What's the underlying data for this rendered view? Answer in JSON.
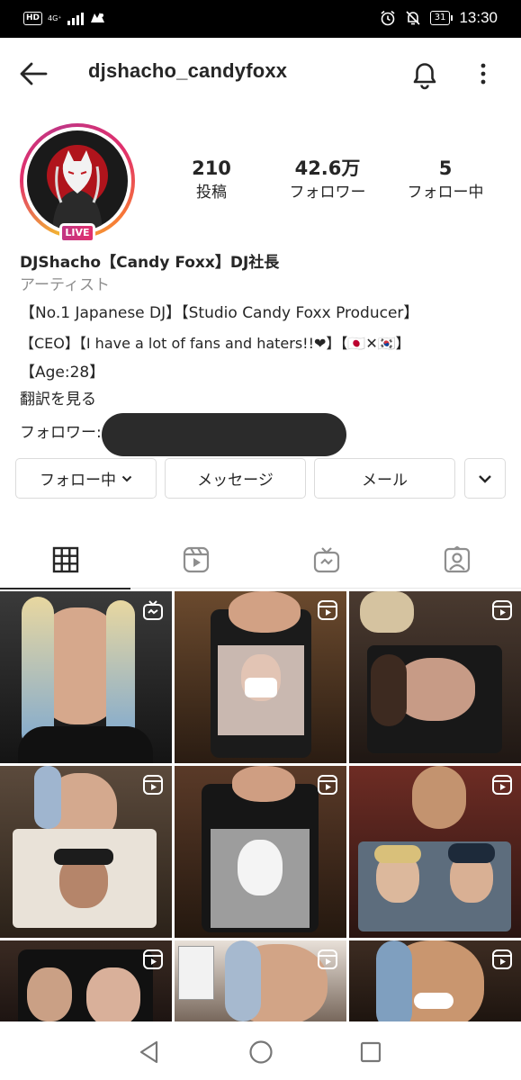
{
  "status_bar": {
    "network": "4G⁺",
    "battery": "31",
    "time": "13:30"
  },
  "header": {
    "username": "djshacho_candyfoxx",
    "icons": [
      "back-arrow-icon",
      "bell-icon",
      "more-vertical-icon"
    ]
  },
  "profile": {
    "live_label": "LIVE",
    "stats": [
      {
        "value": "210",
        "label": "投稿"
      },
      {
        "value": "42.6万",
        "label": "フォロワー"
      },
      {
        "value": "5",
        "label": "フォロー中"
      }
    ],
    "display_name": "DJShacho【Candy Foxx】DJ社長",
    "category": "アーティスト",
    "bio_lines": [
      "【No.1 Japanese DJ】【Studio Candy Foxx Producer】",
      "【CEO】【I have a lot of fans and haters!!❤】【🇯🇵✕🇰🇷】",
      "【Age:28】"
    ],
    "see_translation": "翻訳を見る",
    "followers_prefix": "フォロワー:"
  },
  "actions": {
    "following": "フォロー中",
    "message": "メッセージ",
    "email": "メール"
  },
  "tabs": [
    "grid-icon",
    "reels-icon",
    "igtv-icon",
    "tagged-icon"
  ],
  "grid": {
    "cells": [
      {
        "overlay": "igtv-icon"
      },
      {
        "overlay": "reels-icon"
      },
      {
        "overlay": "reels-icon"
      },
      {
        "overlay": "reels-icon"
      },
      {
        "overlay": "reels-icon"
      },
      {
        "overlay": "reels-icon"
      },
      {
        "overlay": "reels-icon"
      },
      {
        "overlay": "reels-icon"
      },
      {
        "overlay": "reels-icon"
      }
    ]
  },
  "nav_bar": [
    "back-triangle-icon",
    "home-circle-icon",
    "recents-square-icon"
  ]
}
